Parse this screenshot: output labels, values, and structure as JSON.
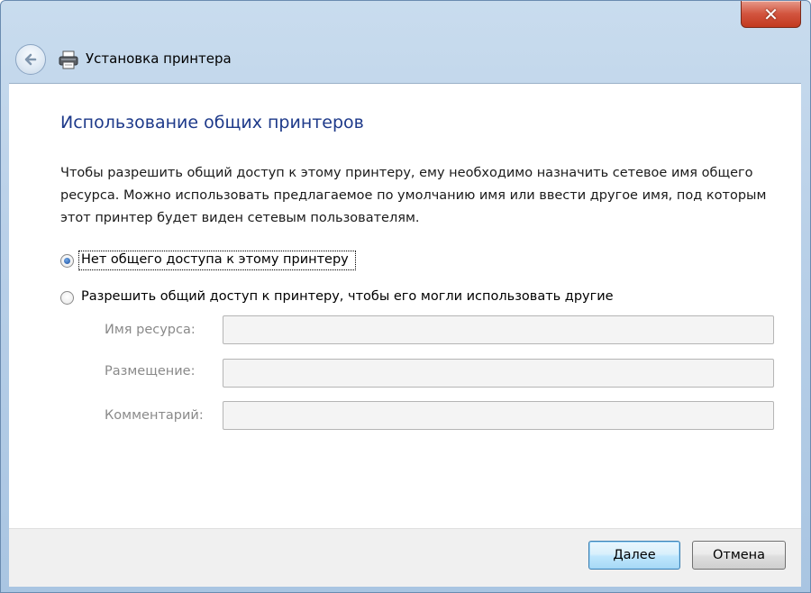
{
  "window": {
    "title": "Установка принтера",
    "close_glyph": "✕"
  },
  "page": {
    "heading": "Использование общих принтеров",
    "description": "Чтобы разрешить общий доступ к этому принтеру, ему необходимо назначить сетевое имя общего ресурса. Можно использовать предлагаемое по умолчанию имя или ввести другое имя, под которым этот принтер будет виден сетевым пользователям."
  },
  "options": [
    {
      "label": "Нет общего доступа к этому принтеру",
      "checked": true
    },
    {
      "label": "Разрешить общий доступ к принтеру, чтобы его могли использовать другие",
      "checked": false
    }
  ],
  "fields": {
    "share_name": {
      "label": "Имя ресурса:",
      "value": ""
    },
    "location": {
      "label": "Размещение:",
      "value": ""
    },
    "comment": {
      "label": "Комментарий:",
      "value": ""
    }
  },
  "buttons": {
    "next": "Далее",
    "cancel": "Отмена"
  },
  "icons": {
    "back": "back-arrow-icon",
    "printer": "printer-icon",
    "close": "close-icon"
  }
}
